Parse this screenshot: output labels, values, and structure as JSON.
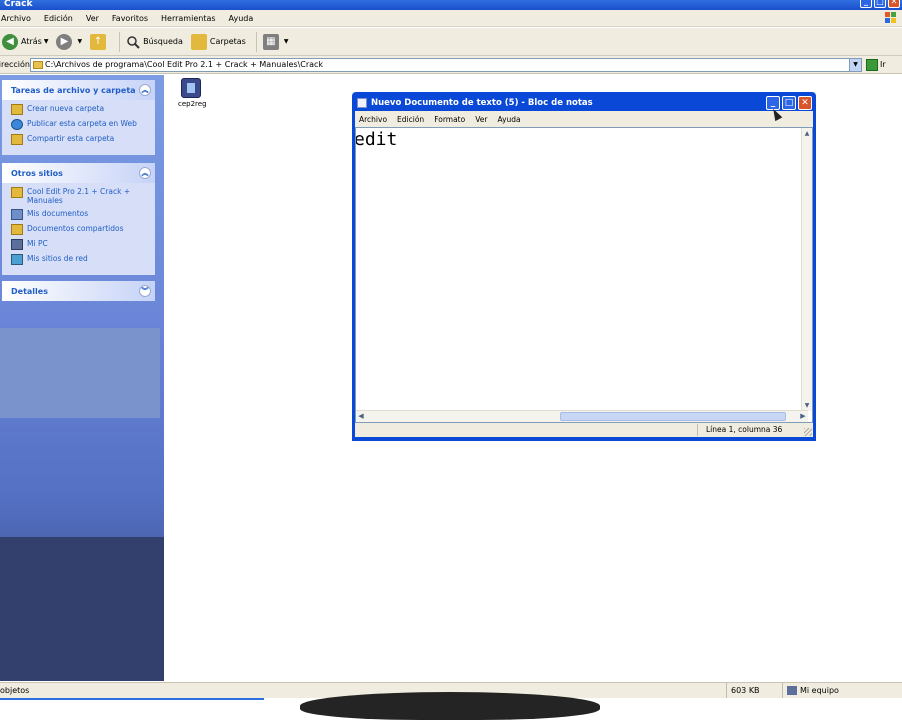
{
  "explorer": {
    "title": "Crack",
    "menu": [
      "Archivo",
      "Edición",
      "Ver",
      "Favoritos",
      "Herramientas",
      "Ayuda"
    ],
    "toolbar": {
      "back": "Atrás",
      "search": "Búsqueda",
      "folders": "Carpetas"
    },
    "address": {
      "label": "Dirección",
      "path": "C:\\Archivos de programa\\Cool Edit Pro 2.1 + Crack + Manuales\\Crack",
      "go": "Ir"
    },
    "tasks_panel": {
      "title": "Tareas de archivo y carpeta",
      "items": [
        "Crear nueva carpeta",
        "Publicar esta carpeta en Web",
        "Compartir esta carpeta"
      ]
    },
    "places_panel": {
      "title": "Otros sitios",
      "items": [
        "Cool Edit Pro 2.1 + Crack + Manuales",
        "Mis documentos",
        "Documentos compartidos",
        "Mi PC",
        "Mis sitios de red"
      ]
    },
    "details_panel": {
      "title": "Detalles"
    },
    "file": {
      "name": "cep2reg"
    },
    "status": {
      "objects": "objetos",
      "size": "603 KB",
      "location": "Mi equipo"
    }
  },
  "notepad": {
    "title": "Nuevo Documento de texto (5) - Bloc de notas",
    "menu": [
      "Archivo",
      "Edición",
      "Formato",
      "Ver",
      "Ayuda"
    ],
    "content": "edit",
    "status": "Línea 1, columna 36"
  }
}
